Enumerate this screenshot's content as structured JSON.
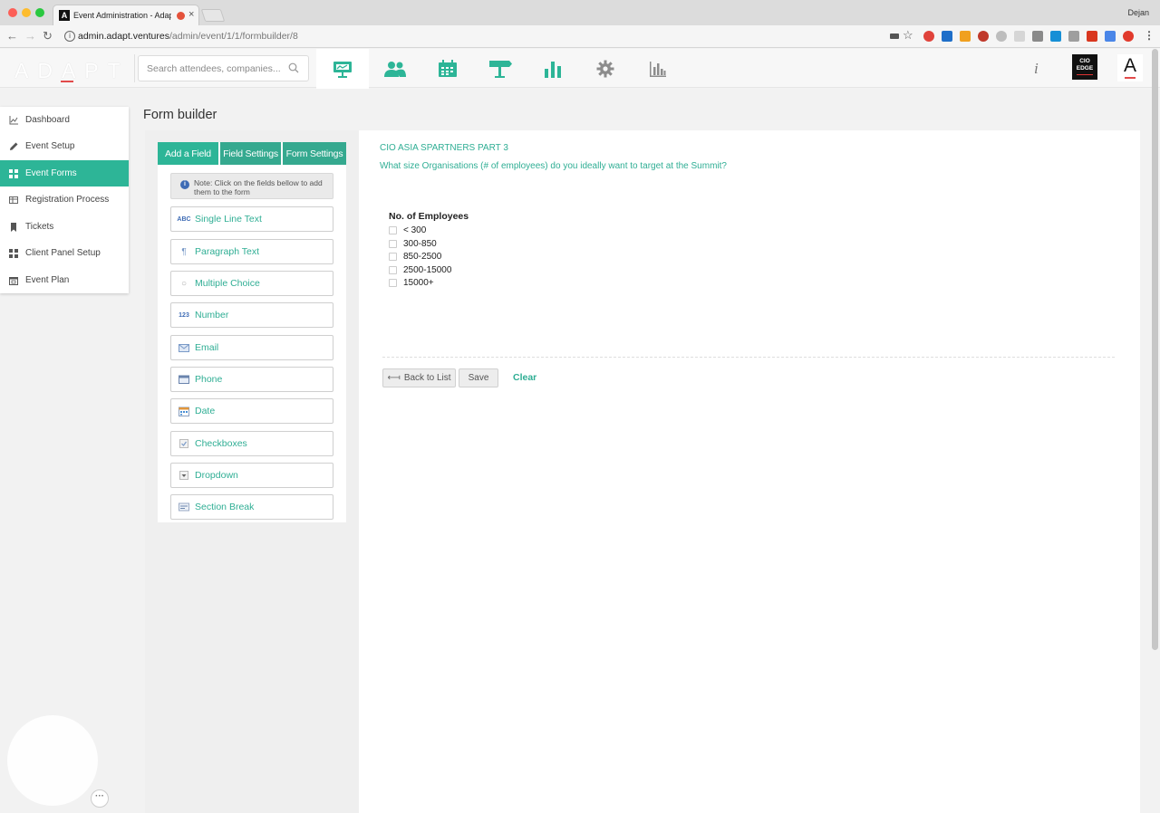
{
  "browser": {
    "tab_title": "Event Administration - Adap",
    "tab_favicon": "A",
    "tab_close": "×",
    "profile_name": "Dejan",
    "url_host": "admin.adapt.ventures",
    "url_path": "/admin/event/1/1/formbuilder/8",
    "nav": {
      "back": "←",
      "forward": "→",
      "reload": "↻"
    },
    "info_glyph": "i",
    "star_glyph": "☆",
    "menu_glyph": "⋮"
  },
  "header": {
    "logo_text": "ADAPT",
    "search_placeholder": "Search attendees, companies...",
    "info_glyph": "i",
    "cio_badge": [
      "CIO",
      "EDGE"
    ],
    "avatar_letter": "A",
    "accent_color": "#2db597",
    "nav_icons": [
      "presentation-icon",
      "attendees-icon",
      "calendar-icon",
      "signpost-icon",
      "bar-chart-icon",
      "gear-icon",
      "analytics-icon"
    ]
  },
  "sidebar": {
    "items": [
      {
        "label": "Dashboard",
        "icon": "line-chart-icon"
      },
      {
        "label": "Event Setup",
        "icon": "pencil-icon"
      },
      {
        "label": "Event Forms",
        "icon": "grid-icon",
        "active": true
      },
      {
        "label": "Registration Process",
        "icon": "table-icon"
      },
      {
        "label": "Tickets",
        "icon": "bookmark-icon"
      },
      {
        "label": "Client Panel Setup",
        "icon": "grid-icon"
      },
      {
        "label": "Event Plan",
        "icon": "calendar-icon"
      }
    ]
  },
  "page": {
    "title": "Form builder"
  },
  "builder": {
    "tabs": [
      {
        "label": "Add a Field",
        "active": true
      },
      {
        "label": "Field Settings"
      },
      {
        "label": "Form Settings"
      }
    ],
    "note": "Note: Click on the fields bellow to add them to the form",
    "field_types": [
      {
        "label": "Single Line Text",
        "icon": "text-abc-icon",
        "glyph": "ABC"
      },
      {
        "label": "Paragraph Text",
        "icon": "paragraph-icon",
        "glyph": "¶"
      },
      {
        "label": "Multiple Choice",
        "icon": "radio-icon",
        "glyph": "○"
      },
      {
        "label": "Number",
        "icon": "number-icon",
        "glyph": "123"
      },
      {
        "label": "Email",
        "icon": "envelope-icon"
      },
      {
        "label": "Phone",
        "icon": "phone-icon"
      },
      {
        "label": "Date",
        "icon": "calendar-icon"
      },
      {
        "label": "Checkboxes",
        "icon": "checkbox-icon"
      },
      {
        "label": "Dropdown",
        "icon": "dropdown-icon"
      },
      {
        "label": "Section Break",
        "icon": "section-break-icon"
      }
    ]
  },
  "form": {
    "title": "CIO ASIA SPARTNERS PART 3",
    "question": "What size Organisations (# of employees) do you ideally want to target at the Summit?",
    "field_label": "No. of Employees",
    "options": [
      "< 300",
      "300-850",
      "850-2500",
      "2500-15000",
      "15000+"
    ],
    "buttons": {
      "back": "Back to List",
      "save": "Save",
      "clear": "Clear"
    },
    "back_glyph": "⟻"
  },
  "chat": {
    "more_glyph": "···"
  }
}
